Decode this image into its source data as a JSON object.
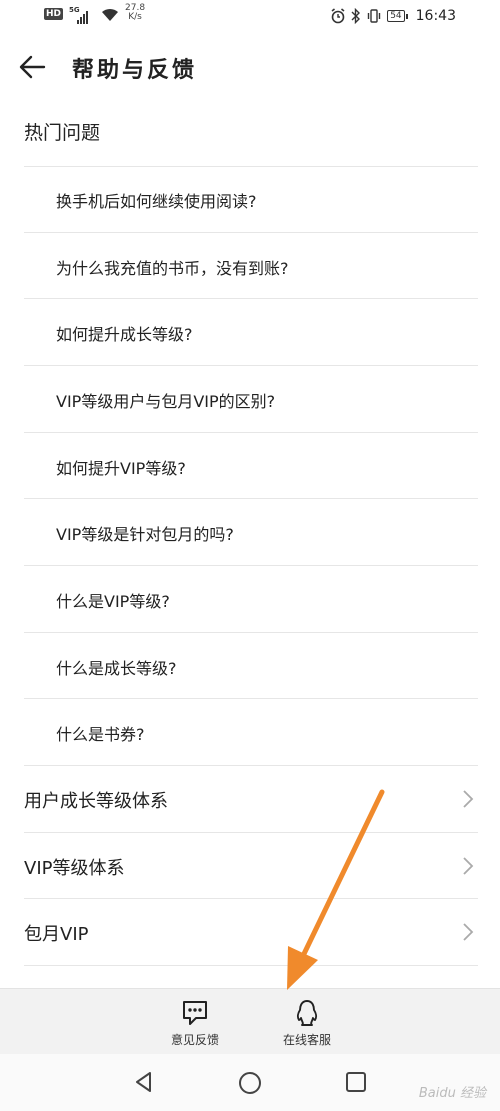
{
  "status_bar": {
    "hd": "HD",
    "network": "5G",
    "speed_value": "27.8",
    "speed_unit": "K/s",
    "battery": "54",
    "time": "16:43"
  },
  "header": {
    "title": "帮助与反馈"
  },
  "section_title": "热门问题",
  "faqs": [
    "换手机后如何继续使用阅读?",
    "为什么我充值的书币，没有到账?",
    "如何提升成长等级?",
    "VIP等级用户与包月VIP的区别?",
    "如何提升VIP等级?",
    "VIP等级是针对包月的吗?",
    "什么是VIP等级?",
    "什么是成长等级?",
    "什么是书券?"
  ],
  "categories": [
    "用户成长等级体系",
    "VIP等级体系",
    "包月VIP"
  ],
  "actions": {
    "feedback_label": "意见反馈",
    "service_label": "在线客服"
  },
  "watermark": "Baidu 经验",
  "colors": {
    "annotation_arrow": "#f08a2c",
    "action_bar": "#f2f2f2"
  }
}
